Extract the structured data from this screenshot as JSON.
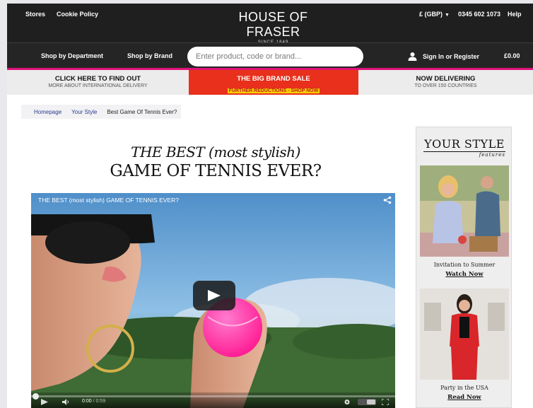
{
  "header": {
    "stores": "Stores",
    "cookie_policy": "Cookie Policy",
    "logo_main": "HOUSE OF FRASER",
    "logo_sub": "SINCE 1849",
    "currency": "£ (GBP)",
    "phone": "0345 602 1073",
    "help": "Help"
  },
  "nav": {
    "shop_by_department": "Shop by Department",
    "shop_by_brand": "Shop by Brand",
    "search_placeholder": "Enter product, code or brand...",
    "sign_in": "Sign In or Register",
    "basket_total": "£0.00"
  },
  "promo": [
    {
      "title": "CLICK HERE TO FIND OUT",
      "sub": "MORE ABOUT INTERNATIONAL DELIVERY"
    },
    {
      "title": "THE BIG BRAND SALE",
      "sub": "FURTHER REDUCTIONS - SHOP NOW"
    },
    {
      "title": "NOW DELIVERING",
      "sub": "TO OVER 150 COUNTRIES"
    }
  ],
  "breadcrumb": [
    "Homepage",
    "Your Style",
    "Best Game Of Tennis Ever?"
  ],
  "article": {
    "headline_line1": "THE BEST (most stylish)",
    "headline_line2": "GAME OF TENNIS EVER?"
  },
  "video": {
    "title": "THE BEST (most stylish) GAME OF TENNIS EVER?",
    "current_time": "0:00",
    "duration": "/ 0:59",
    "progress": 0
  },
  "sidebar": {
    "title": "YOUR STYLE",
    "subtitle": "features",
    "features": [
      {
        "caption": "Invitation to Summer",
        "link": "Watch Now"
      },
      {
        "caption": "Party in the USA",
        "link": "Read Now"
      }
    ]
  },
  "colors": {
    "header_bg": "#1f1f1f",
    "accent_pink": "#e0127a",
    "sale_red": "#e8301c",
    "sale_yellow": "#f6d000",
    "link_blue": "#2b3a8c",
    "tennis_ball": "#ff2fa0"
  },
  "icons": [
    "chevron-down-icon",
    "user-icon",
    "share-icon",
    "play-icon",
    "volume-icon",
    "settings-icon",
    "youtube-logo",
    "fullscreen-icon"
  ]
}
